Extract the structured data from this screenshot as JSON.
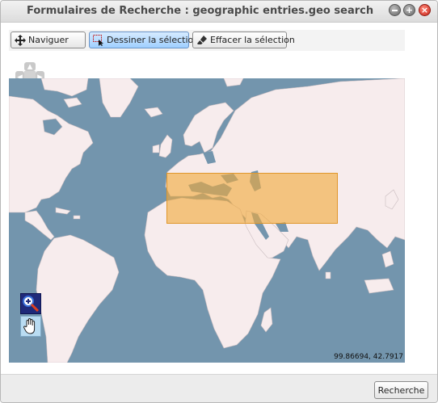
{
  "window": {
    "title": "Formulaires de Recherche : geographic entries.geo search"
  },
  "toolbar": {
    "navigate_label": "Naviguer",
    "draw_label": "Dessiner la sélection",
    "clear_label": "Effacer la sélection"
  },
  "map": {
    "coordinates": "99.86694, 42.7917",
    "selection_color": "#f0aa3c",
    "ocean_color": "#7395ad",
    "land_color": "#f7eced"
  },
  "footer": {
    "search_label": "Recherche"
  }
}
